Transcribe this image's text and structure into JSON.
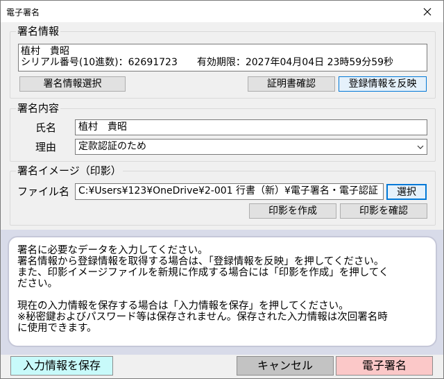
{
  "window": {
    "title": "電子署名"
  },
  "sign_info": {
    "legend": "署名情報",
    "line1": "植村　貴昭",
    "line2": "シリアル番号(10進数)：62691723　　有効期限：2027年04月04日 23時59分59秒",
    "select_button": "署名情報選択",
    "cert_button": "証明書確認",
    "apply_button": "登録情報を反映"
  },
  "sign_content": {
    "legend": "署名内容",
    "name_label": "氏名",
    "name_value": "植村　貴昭",
    "reason_label": "理由",
    "reason_value": "定款認証のため"
  },
  "sign_image": {
    "legend": "署名イメージ（印影）",
    "file_label": "ファイル名",
    "file_value": "C:¥Users¥123¥OneDrive¥2-001 行書（新）¥電子署名・電子認証",
    "select_button": "選択",
    "create_button": "印影を作成",
    "confirm_button": "印影を確認"
  },
  "help": {
    "lines": [
      "署名に必要なデータを入力してください。",
      "署名情報から登録情報を取得する場合は、「登録情報を反映」を押してください。",
      "また、印影イメージファイルを新規に作成する場合には「印影を作成」を押してく",
      "ださい。",
      "",
      "現在の入力情報を保存する場合は「入力情報を保存」を押してください。",
      "※秘密鍵およびパスワード等は保存されません。保存された入力情報は次回署名時",
      "に使用できます。"
    ]
  },
  "footer": {
    "save_button": "入力情報を保存",
    "cancel_button": "キャンセル",
    "sign_button": "電子署名"
  },
  "colors": {
    "save_bg": "#c8fafa",
    "cancel_bg": "#c3c3c3",
    "sign_bg": "#fbc8c8",
    "help_area_bg": "#d8dbe9"
  }
}
